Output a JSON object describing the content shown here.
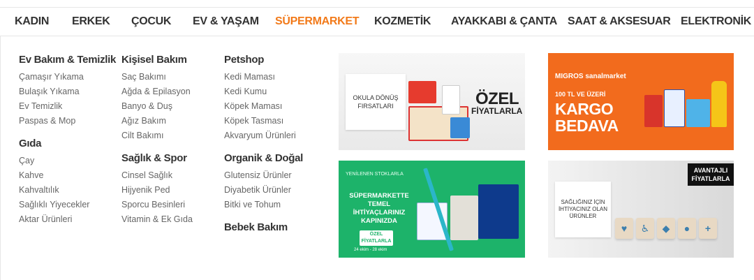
{
  "nav": {
    "items": [
      {
        "label": "KADIN"
      },
      {
        "label": "ERKEK"
      },
      {
        "label": "ÇOCUK"
      },
      {
        "label": "EV & YAŞAM"
      },
      {
        "label": "SÜPERMARKET",
        "active": true
      },
      {
        "label": "KOZMETİK"
      },
      {
        "label": "AYAKKABI & ÇANTA"
      },
      {
        "label": "SAAT & AKSESUAR"
      },
      {
        "label": "ELEKTRONİK"
      }
    ]
  },
  "menu": {
    "col1": [
      {
        "title": "Ev Bakım & Temizlik",
        "links": [
          "Çamaşır Yıkama",
          "Bulaşık Yıkama",
          "Ev Temizlik",
          "Paspas & Mop"
        ]
      },
      {
        "title": "Gıda",
        "links": [
          "Çay",
          "Kahve",
          "Kahvaltılık",
          "Sağlıklı Yiyecekler",
          "Aktar Ürünleri"
        ]
      }
    ],
    "col2": [
      {
        "title": "Kişisel Bakım",
        "links": [
          "Saç Bakımı",
          "Ağda & Epilasyon",
          "Banyo & Duş",
          "Ağız Bakım",
          "Cilt Bakımı"
        ]
      },
      {
        "title": "Sağlık & Spor",
        "links": [
          "Cinsel Sağlık",
          "Hijyenik Ped",
          "Sporcu Besinleri",
          "Vitamin & Ek Gıda"
        ]
      }
    ],
    "col3": [
      {
        "title": "Petshop",
        "links": [
          "Kedi Maması",
          "Kedi Kumu",
          "Köpek Maması",
          "Köpek Tasması",
          "Akvaryum Ürünleri"
        ]
      },
      {
        "title": "Organik & Doğal",
        "links": [
          "Glutensiz Ürünler",
          "Diyabetik Ürünler",
          "Bitki ve Tohum"
        ]
      },
      {
        "title": "Bebek Bakım",
        "links": []
      }
    ]
  },
  "banners": {
    "school": {
      "box_text": "OKULA DÖNÜŞ FIRSATLARI",
      "headline": "ÖZEL",
      "subline": "FİYATLARLA"
    },
    "migros": {
      "brand": "MIGROS sanalmarket",
      "subline": "100 TL VE ÜZERİ",
      "headline_1": "KARGO",
      "headline_2": "BEDAVA"
    },
    "supermarket": {
      "small": "YENİLENEN STOKLARLA",
      "headline": "SÜPERMARKETTE TEMEL İHTİYAÇLARINIZ KAPINIZDA",
      "tag": "ÖZEL FİYATLARLA",
      "dates": "24 ekim - 28 ekim"
    },
    "health": {
      "box_text": "SAĞLIĞINIZ İÇİN İHTİYACINIZ OLAN ÜRÜNLER",
      "flag": "AVANTAJLI FİYATLARLA"
    }
  },
  "colors": {
    "accent": "#f27a1a",
    "migros": "#f26b1d",
    "green": "#1db36a"
  }
}
